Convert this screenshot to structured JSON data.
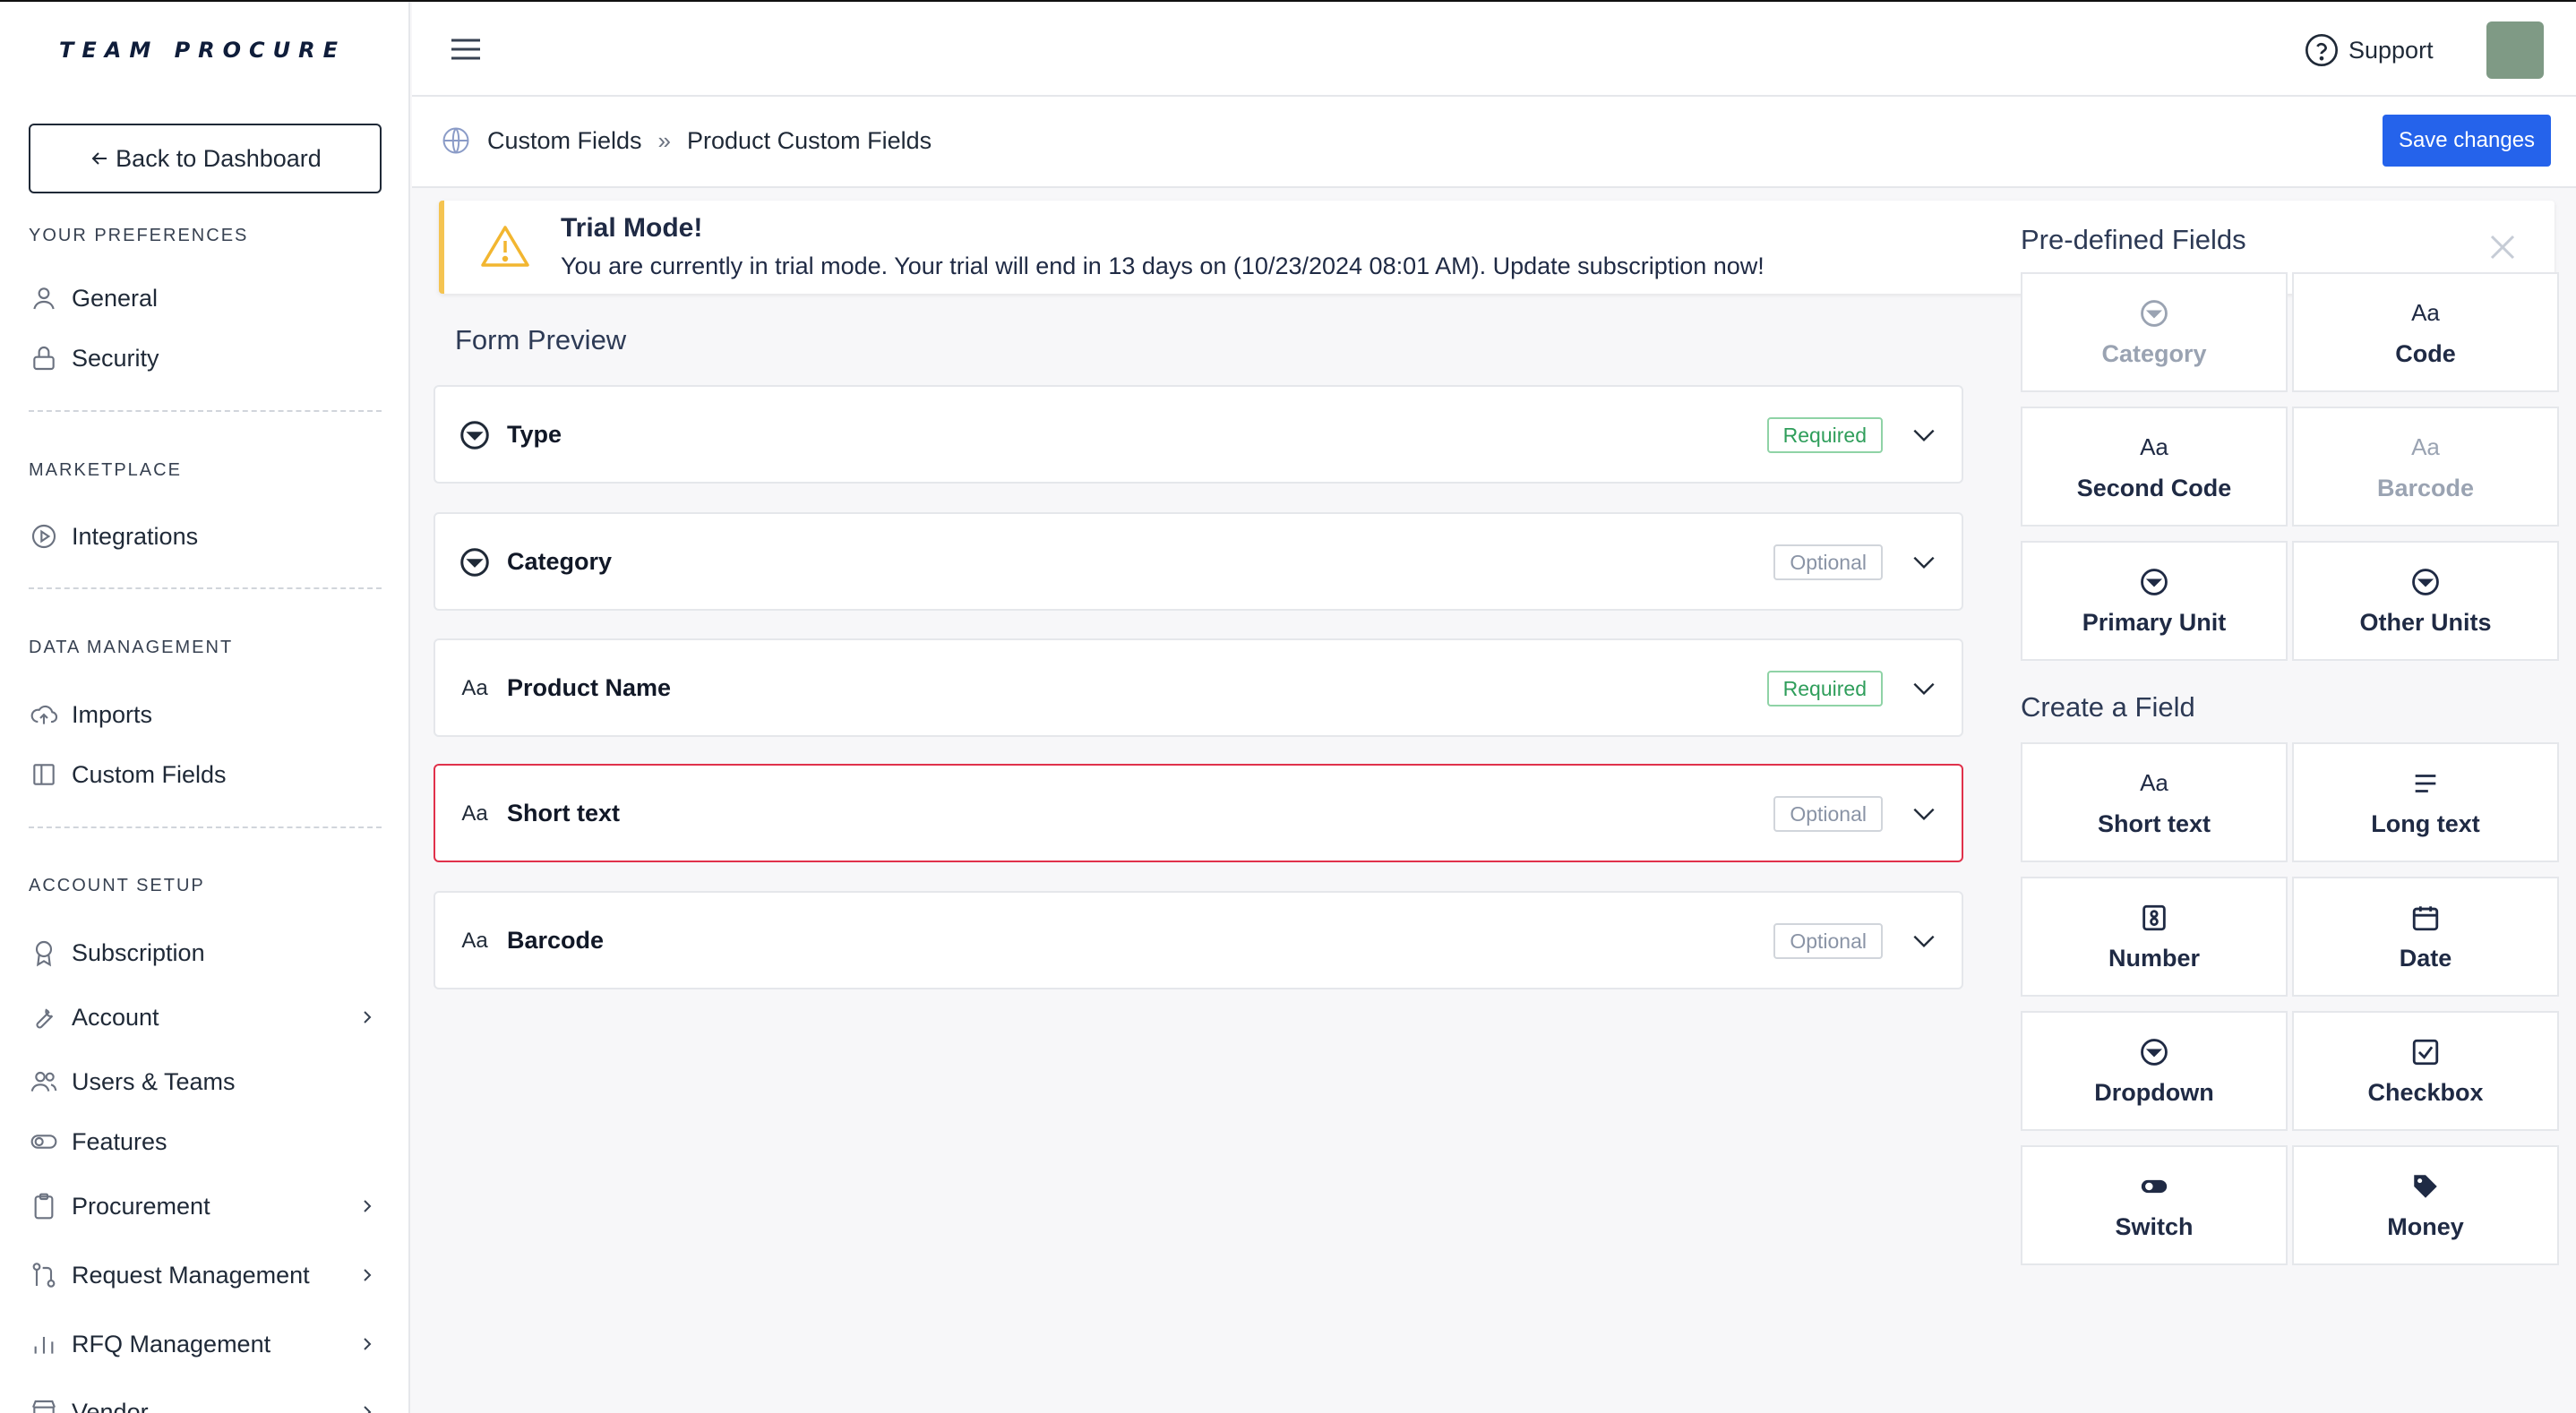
{
  "brand": {
    "logo": "TEAM PROCURE"
  },
  "sidebar": {
    "back_label": "Back to Dashboard",
    "sections": {
      "preferences": "YOUR PREFERENCES",
      "marketplace": "MARKETPLACE",
      "data": "DATA MANAGEMENT",
      "account": "ACCOUNT SETUP"
    },
    "items": {
      "general": "General",
      "security": "Security",
      "integrations": "Integrations",
      "imports": "Imports",
      "custom_fields": "Custom Fields",
      "subscription": "Subscription",
      "account": "Account",
      "users_teams": "Users & Teams",
      "features": "Features",
      "procurement": "Procurement",
      "request_management": "Request Management",
      "rfq_management": "RFQ Management",
      "vendor": "Vendor"
    }
  },
  "topbar": {
    "support": "Support"
  },
  "breadcrumb": {
    "root": "Custom Fields",
    "separator": "»",
    "current": "Product Custom Fields"
  },
  "actions": {
    "save": "Save changes"
  },
  "banner": {
    "title": "Trial Mode!",
    "message": "You are currently in trial mode. Your trial will end in 13 days on (10/23/2024 08:01 AM). Update subscription now!"
  },
  "form_preview": {
    "title": "Form Preview",
    "icon_text": "Aa",
    "rows": [
      {
        "label": "Type",
        "status": "Required",
        "icon": "dropdown-icon"
      },
      {
        "label": "Category",
        "status": "Optional",
        "icon": "dropdown-icon"
      },
      {
        "label": "Product Name",
        "status": "Required",
        "icon": "text-icon"
      },
      {
        "label": "Short text",
        "status": "Optional",
        "icon": "text-icon"
      },
      {
        "label": "Barcode",
        "status": "Optional",
        "icon": "text-icon"
      }
    ]
  },
  "predefined": {
    "title": "Pre-defined Fields",
    "icon_text": "Aa",
    "fields": {
      "category": "Category",
      "code": "Code",
      "second_code": "Second Code",
      "barcode": "Barcode",
      "primary_unit": "Primary Unit",
      "other_units": "Other Units"
    }
  },
  "create": {
    "title": "Create a Field",
    "icon_text": "Aa",
    "fields": {
      "short_text": "Short text",
      "long_text": "Long text",
      "number": "Number",
      "date": "Date",
      "dropdown": "Dropdown",
      "checkbox": "Checkbox",
      "switch": "Switch",
      "money": "Money"
    }
  },
  "colors": {
    "primary": "#2563eb",
    "required": "#2f9e5b",
    "warning": "#f5c451",
    "active_border": "#e0314b"
  }
}
